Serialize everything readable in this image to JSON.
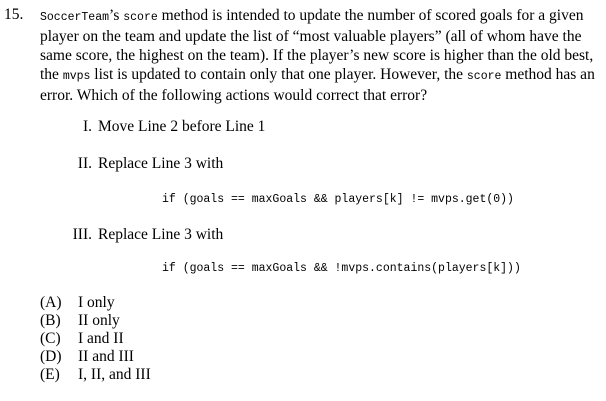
{
  "question": {
    "number": "15.",
    "stem_parts": [
      {
        "t": "code",
        "v": "SoccerTeam"
      },
      {
        "t": "text",
        "v": "’s "
      },
      {
        "t": "code",
        "v": "score"
      },
      {
        "t": "text",
        "v": " method is intended to update the number of scored goals for a given player on the team and update the list of “most valuable players” (all of whom have the same score, the highest on the team).  If the player’s new score is higher than the old best, the "
      },
      {
        "t": "code",
        "v": "mvps"
      },
      {
        "t": "text",
        "v": " list is updated to contain only that one player.  However, the "
      },
      {
        "t": "code",
        "v": "score"
      },
      {
        "t": "text",
        "v": " method has an error.  Which of the following actions would correct that error?"
      }
    ]
  },
  "statements": [
    {
      "numeral": "I.",
      "text": "Move Line 2 before Line 1",
      "code": ""
    },
    {
      "numeral": "II.",
      "text": "Replace Line 3 with",
      "code": "if (goals == maxGoals && players[k] != mvps.get(0))"
    },
    {
      "numeral": "III.",
      "text": "Replace Line 3 with",
      "code": "if (goals == maxGoals && !mvps.contains(players[k]))"
    }
  ],
  "choices": [
    {
      "letter": "(A)",
      "text": "I only"
    },
    {
      "letter": "(B)",
      "text": "II only"
    },
    {
      "letter": "(C)",
      "text": "I and II"
    },
    {
      "letter": "(D)",
      "text": "II and III"
    },
    {
      "letter": "(E)",
      "text": "I, II, and III"
    }
  ]
}
